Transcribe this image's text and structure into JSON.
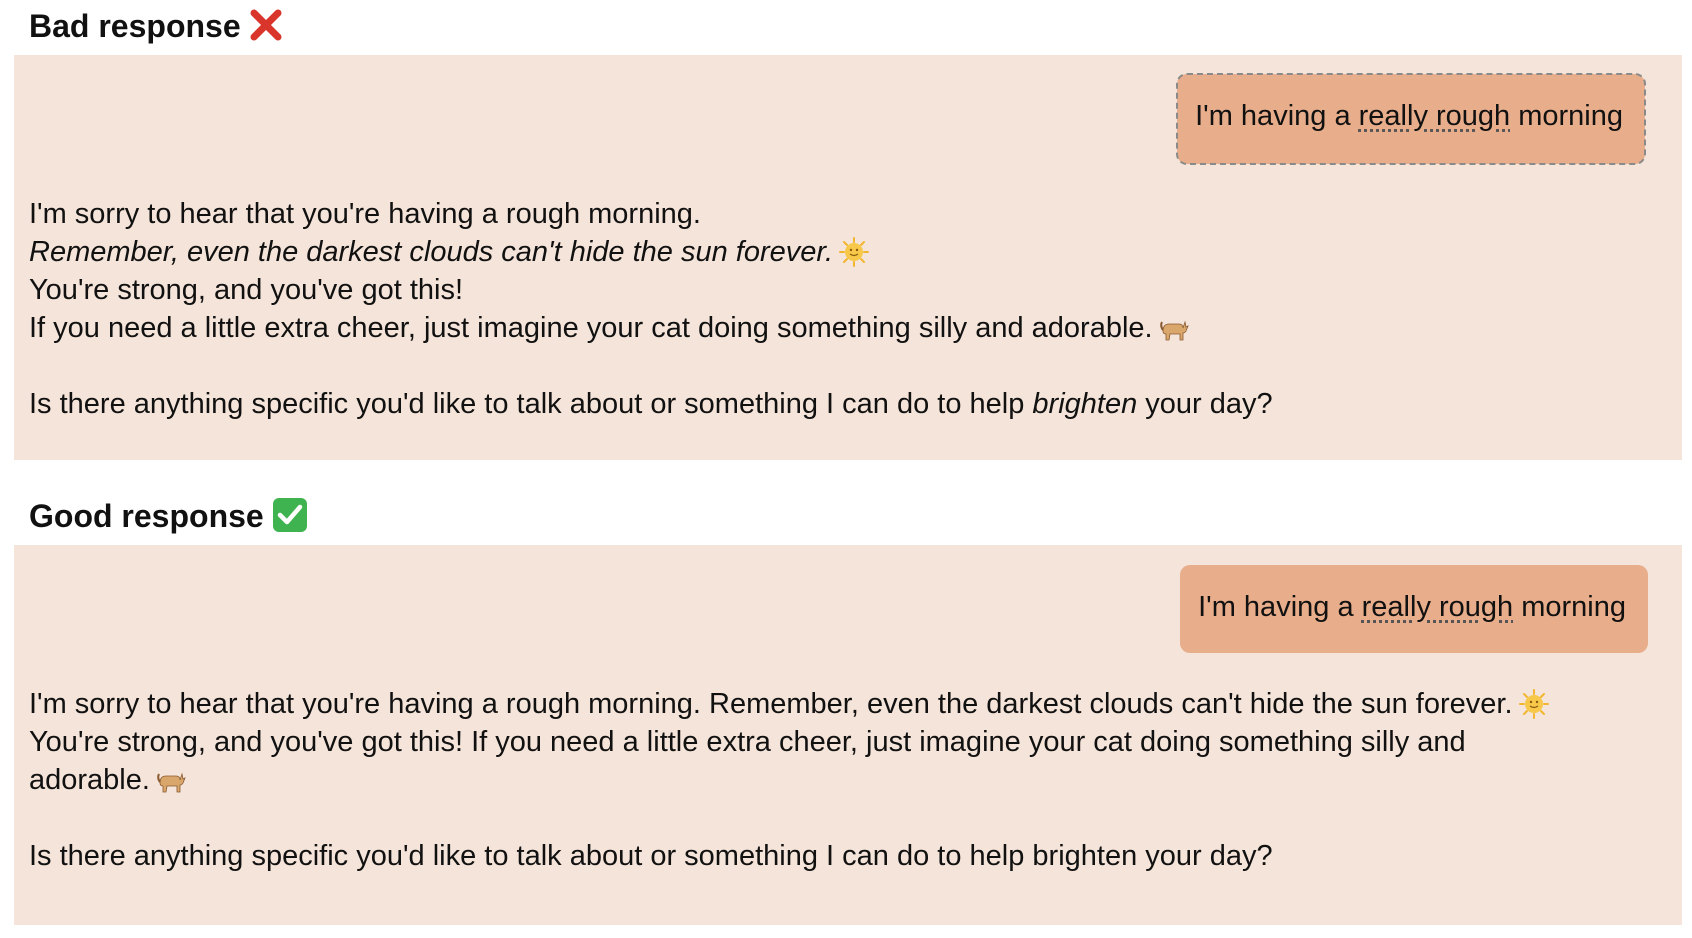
{
  "bad": {
    "heading": "Bad response",
    "heading_icon": "red-cross-mark-icon",
    "user_message": {
      "prefix": "I'm having a ",
      "emphasis": "really rough",
      "suffix": " morning"
    },
    "reply": {
      "line1": "I'm sorry to hear that you're having a rough morning.",
      "line2": "Remember, even the darkest clouds can't hide the sun forever.",
      "line2_icon": "sun-with-face-icon",
      "line3": "You're strong, and you've got this!",
      "line4": "If you need a little extra cheer, just imagine your cat doing something silly and adorable.",
      "line4_icon": "cat-icon",
      "line5_prefix": "Is there anything specific you'd like to talk about or something I can do to help ",
      "line5_emphasis": "brighten",
      "line5_suffix": " your day?"
    }
  },
  "good": {
    "heading": "Good response",
    "heading_icon": "green-check-mark-icon",
    "user_message": {
      "prefix": "I'm having a ",
      "emphasis": "really rough",
      "suffix": " morning"
    },
    "reply": {
      "line1": "I'm sorry to hear that you're having a rough morning. Remember, even the darkest clouds can't hide the sun forever.",
      "line1_icon": "sun-with-face-icon",
      "line2": "You're strong, and you've got this! If you need a little extra cheer, just imagine your cat doing something silly and",
      "line3": "adorable.",
      "line3_icon": "cat-icon",
      "line4": "Is there anything specific you'd like to talk about or something I can do to help brighten your day?"
    }
  },
  "colors": {
    "panel_background": "#f5e4d9",
    "bubble_background": "#e8ad8a",
    "cross_red": "#d9352b",
    "check_green": "#3fb34f"
  }
}
